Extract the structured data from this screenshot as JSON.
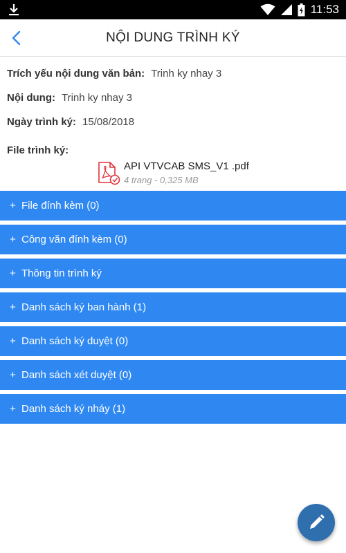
{
  "status_bar": {
    "time": "11:53",
    "icons": [
      "download-icon",
      "wifi-icon",
      "signal-icon",
      "battery-icon"
    ]
  },
  "header": {
    "title": "NỘI DUNG TRÌNH KÝ",
    "back_icon": "chevron-left-icon"
  },
  "details": {
    "summary_label": "Trích yếu nội dung văn bản:",
    "summary_value": "Trinh ky nhay 3",
    "content_label": "Nội dung:",
    "content_value": "Trinh ky nhay 3",
    "date_label": "Ngày trình ký:",
    "date_value": "15/08/2018",
    "file_label": "File trình ký:"
  },
  "file": {
    "name": "API VTVCAB SMS_V1 .pdf",
    "info": "4 trang - 0,325 MB",
    "icon": "pdf-signed-icon"
  },
  "sections": [
    {
      "plus": "+",
      "label": "File đính kèm (0)"
    },
    {
      "plus": "+",
      "label": "Công văn đính kèm (0)"
    },
    {
      "plus": "+",
      "label": "Thông tin trình ký"
    },
    {
      "plus": "+",
      "label": "Danh sách ký ban hành  (1)"
    },
    {
      "plus": "+",
      "label": "Danh sách ký duyệt  (0)"
    },
    {
      "plus": "+",
      "label": "Danh sách xét duyệt  (0)"
    },
    {
      "plus": "+",
      "label": "Danh sách ký nháy (1)"
    }
  ],
  "fab": {
    "icon": "pencil-icon"
  },
  "colors": {
    "section_bg": "#2f88f2",
    "fab_bg": "#2f6fad",
    "back_arrow": "#2f88f2",
    "pdf_red": "#e0333c"
  }
}
